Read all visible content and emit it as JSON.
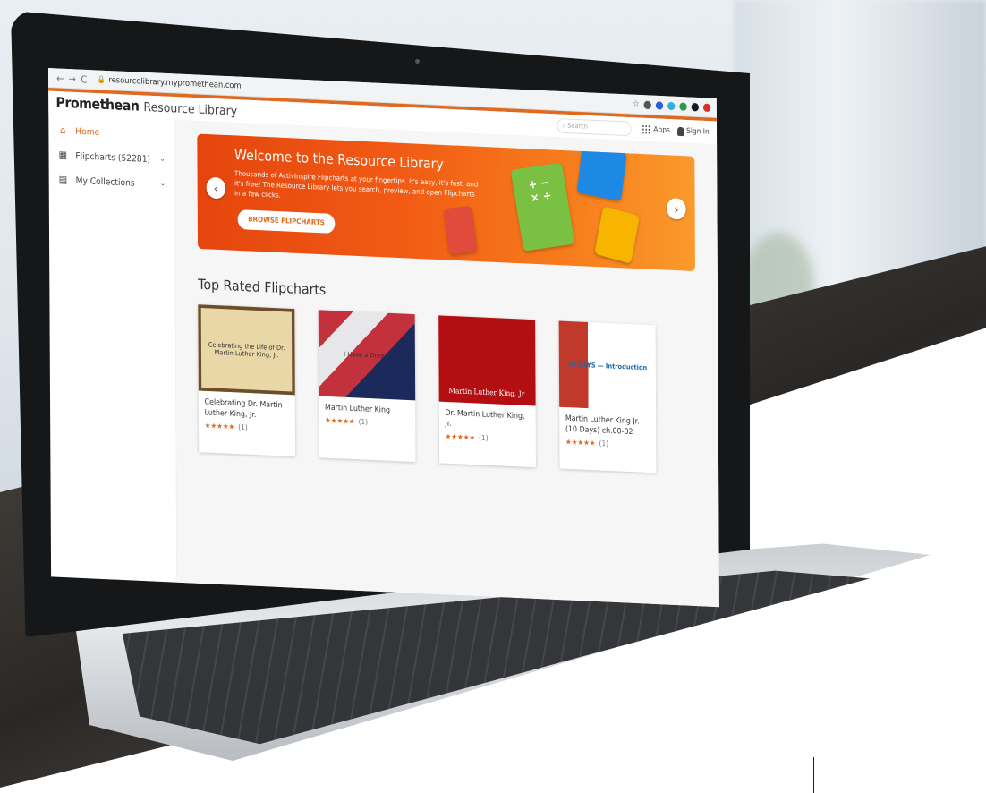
{
  "browser": {
    "url": "resourcelibrary.mypromethean.com",
    "back_icon": "←",
    "forward_icon": "→",
    "reload_icon": "C",
    "ext_colors": [
      "#555555",
      "#2b5fd9",
      "#2bb3e6",
      "#2c9a4a",
      "#1a1a1a",
      "#d93025"
    ]
  },
  "header": {
    "brand": "Promethean",
    "subtitle": "Resource Library",
    "search_placeholder": "Search",
    "apps_label": "Apps",
    "signin_label": "Sign In"
  },
  "sidebar": {
    "items": [
      {
        "label": "Home",
        "icon": "home-icon",
        "glyph": "⌂"
      },
      {
        "label": "Flipcharts (52281)",
        "icon": "flipchart-icon",
        "glyph": "▦",
        "chevron": "⌄"
      },
      {
        "label": "My Collections",
        "icon": "collections-icon",
        "glyph": "▤",
        "chevron": "⌄"
      }
    ]
  },
  "banner": {
    "title": "Welcome to the Resource Library",
    "description": "Thousands of ActivInspire Flipcharts at your fingertips. It's easy, it's fast, and it's free! The Resource Library lets you search, preview, and open Flipcharts in a few clicks.",
    "button_label": "BROWSE FLIPCHARTS",
    "prev_icon": "‹",
    "next_icon": "›",
    "tile_glyphs": [
      "+ −\n× ÷",
      "",
      "",
      ""
    ]
  },
  "top_rated": {
    "title": "Top Rated Flipcharts",
    "cards": [
      {
        "thumb_text": "Celebrating the Life of Dr. Martin Luther King, Jr.",
        "name": "Celebrating Dr. Martin Luther King, Jr.",
        "stars": "★★★★★",
        "count": "(1)"
      },
      {
        "thumb_text": "I Have a Dream",
        "name": "Martin Luther King",
        "stars": "★★★★★",
        "count": "(1)"
      },
      {
        "thumb_text": "Martin Luther King, Jr.",
        "name": "Dr. Martin Luther King, Jr.",
        "stars": "★★★★★",
        "count": "(1)"
      },
      {
        "thumb_text": "10 DAYS — Introduction",
        "name": "Martin Luther King Jr. (10 Days) ch.00-02",
        "stars": "★★★★★",
        "count": "(1)"
      }
    ]
  },
  "colors": {
    "accent": "#e0691f",
    "banner": "#f15a14"
  }
}
